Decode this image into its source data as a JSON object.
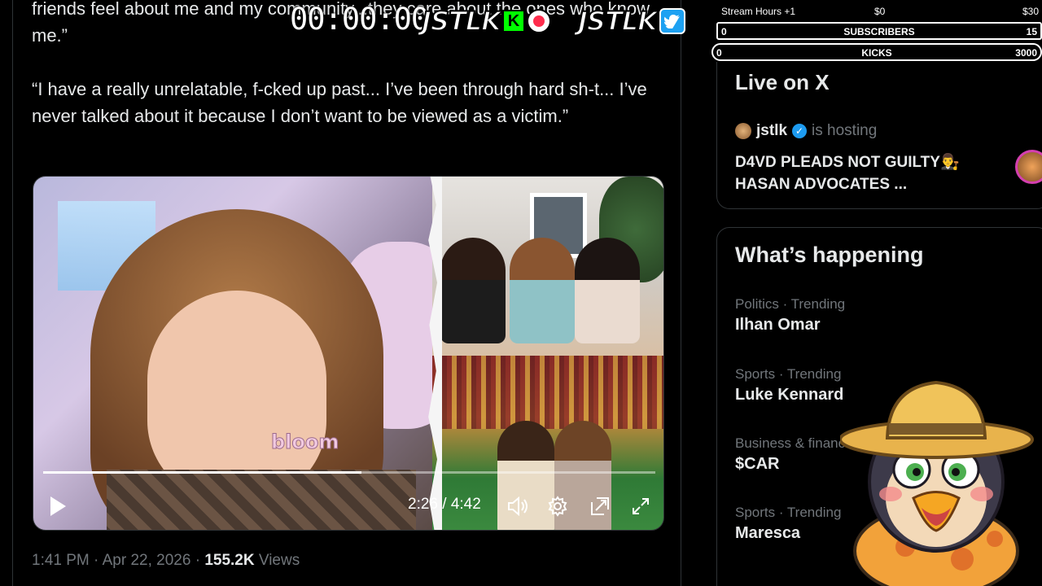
{
  "tweet": {
    "paragraphs": [
      "friends feel about me and my community...they care about the ones who know me.”",
      "“I have a really unrelatable, f-cked up past... I’ve been through hard sh-t... I’ve never talked about it because I don’t want to be viewed as a victim.”"
    ],
    "media": {
      "watermark": "bloom",
      "current_time": "2:26",
      "duration": "4:42",
      "time_display": "2:26 / 4:42",
      "progress": 0.52
    },
    "meta": {
      "time": "1:41 PM",
      "date": "Apr 22, 2026",
      "views_count": "155.2K",
      "views_label": "Views"
    }
  },
  "overlay": {
    "timer": "00:00:00",
    "brand": "JSTLK",
    "brand_secondary": "JSTLK",
    "kick_letter": "K",
    "accent_colors": {
      "kick": "#00ff00",
      "twitter": "#1da1f2",
      "record": "#ff2d4d"
    }
  },
  "stream_stats": {
    "hours_label": "Stream Hours +1",
    "hours_min": "$0",
    "hours_max": "$30",
    "subs_min": "0",
    "subs_label": "SUBSCRIBERS",
    "subs_max": "15",
    "kicks_min": "0",
    "kicks_label": "KICKS",
    "kicks_max": "3000"
  },
  "live": {
    "heading": "Live on X",
    "host_name": "jstlk",
    "host_label": "is hosting",
    "title_line1": "D4VD PLEADS NOT GUILTY👨‍⚖️",
    "title_line2": "HASAN ADVOCATES ..."
  },
  "whats_happening": {
    "heading": "What’s happening",
    "trends": [
      {
        "category": "Politics · Trending",
        "name": "Ilhan Omar"
      },
      {
        "category": "Sports · Trending",
        "name": "Luke Kennard"
      },
      {
        "category": "Business & finance",
        "name": "$CAR"
      },
      {
        "category": "Sports · Trending",
        "name": "Maresca"
      }
    ]
  }
}
